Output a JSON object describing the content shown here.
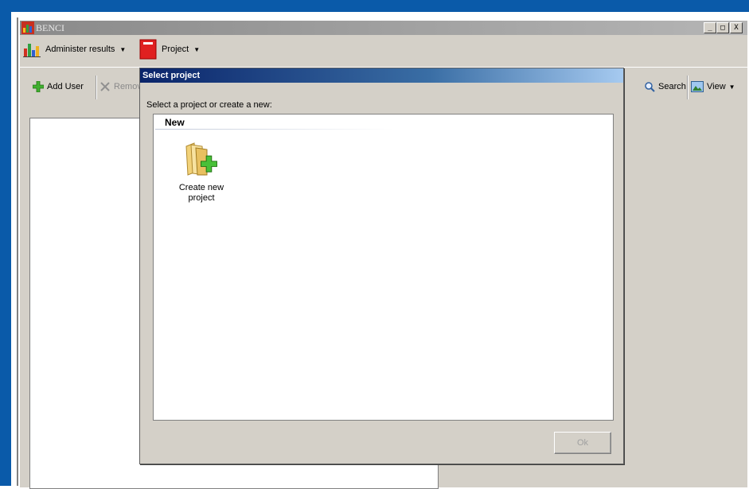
{
  "window": {
    "title": "BENCI",
    "min_label": "_",
    "max_label": "□",
    "close_label": "X"
  },
  "menu": {
    "administer_results": "Administer results",
    "project": "Project"
  },
  "toolbar": {
    "add_user": "Add User",
    "remove": "Remove",
    "search": "Search",
    "view": "View"
  },
  "dialog": {
    "title": "Select project",
    "prompt": "Select a project or create a new:",
    "group_header": "New",
    "items": [
      {
        "label_line1": "Create new",
        "label_line2": "project"
      }
    ],
    "ok_label": "Ok"
  },
  "colors": {
    "frame_blue": "#0a5aa9",
    "dialog_title_start": "#0a246a",
    "dialog_title_end": "#a6caf0",
    "ok_disabled_text": "#a0a0a0"
  },
  "icons": {
    "app": "app-chart-icon",
    "administer": "bar-chart-icon",
    "project": "red-book-icon",
    "add_user": "green-plus-icon",
    "remove": "gray-x-icon",
    "search": "magnifier-icon",
    "view": "picture-icon",
    "create_project": "folder-add-icon"
  }
}
